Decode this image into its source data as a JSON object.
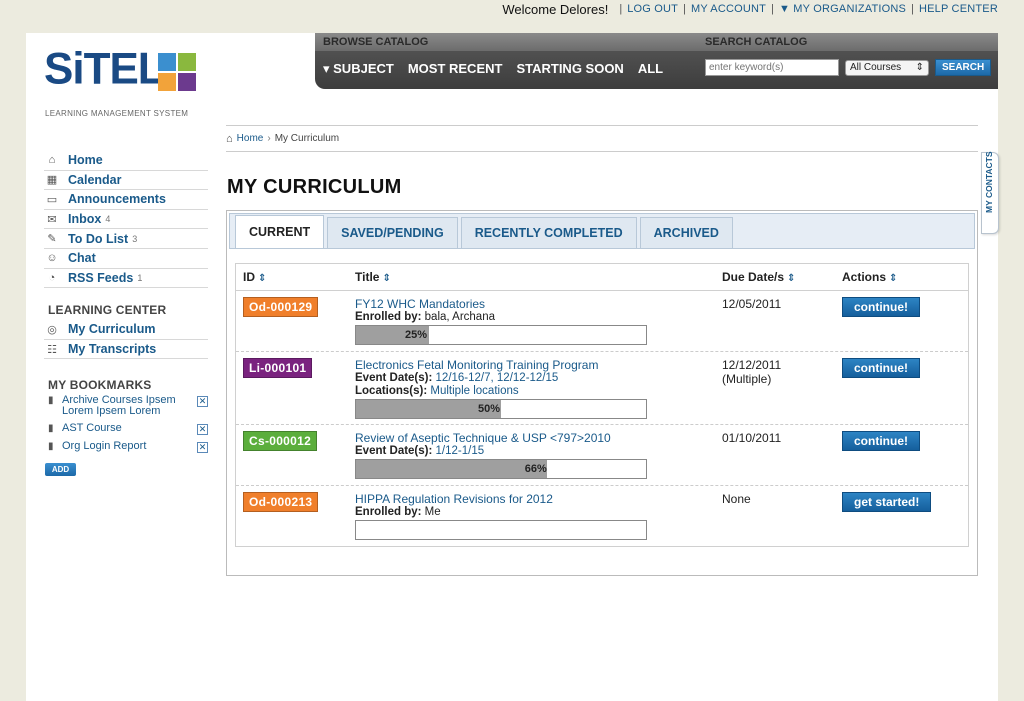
{
  "topbar": {
    "welcome": "Welcome Delores!",
    "logout": "LOG OUT",
    "my_account": "MY ACCOUNT",
    "my_organizations": "MY ORGANIZATIONS",
    "help_center": "HELP CENTER"
  },
  "logo": {
    "wordmark": "SiTEL",
    "tagline": "LEARNING MANAGEMENT SYSTEM"
  },
  "catalog": {
    "browse_label": "BROWSE CATALOG",
    "search_label": "SEARCH CATALOG",
    "nav": [
      "▾ SUBJECT",
      "MOST RECENT",
      "STARTING SOON",
      "ALL"
    ],
    "search_placeholder": "enter keyword(s)",
    "scope_selected": "All Courses",
    "search_button": "SEARCH"
  },
  "sidebar": {
    "items": [
      {
        "label": "Home",
        "icon": "home-icon",
        "count": ""
      },
      {
        "label": "Calendar",
        "icon": "calendar-icon",
        "count": ""
      },
      {
        "label": "Announcements",
        "icon": "announcement-icon",
        "count": ""
      },
      {
        "label": "Inbox",
        "icon": "inbox-icon",
        "count": "4"
      },
      {
        "label": "To Do List",
        "icon": "pin-icon",
        "count": "3"
      },
      {
        "label": "Chat",
        "icon": "chat-icon",
        "count": ""
      },
      {
        "label": "RSS Feeds",
        "icon": "rss-icon",
        "count": "1"
      }
    ],
    "learning_center_heading": "LEARNING CENTER",
    "learning_center": [
      {
        "label": "My Curriculum",
        "icon": "curriculum-icon"
      },
      {
        "label": "My Transcripts",
        "icon": "transcripts-icon"
      }
    ],
    "bookmarks_heading": "MY BOOKMARKS",
    "bookmarks": [
      {
        "label": "Archive Courses Ipsem Lorem Ipsem Lorem"
      },
      {
        "label": "AST Course"
      },
      {
        "label": "Org Login Report"
      }
    ],
    "add_button": "ADD"
  },
  "contacts_tab": "MY CONTACTS",
  "breadcrumb": {
    "home": "Home",
    "current": "My Curriculum"
  },
  "page_title": "MY CURRICULUM",
  "tabs": [
    {
      "label": "CURRENT",
      "active": true
    },
    {
      "label": "SAVED/PENDING",
      "active": false
    },
    {
      "label": "RECENTLY COMPLETED",
      "active": false
    },
    {
      "label": "ARCHIVED",
      "active": false
    }
  ],
  "table": {
    "headers": {
      "id": "ID",
      "title": "Title",
      "due": "Due Date/s",
      "actions": "Actions"
    },
    "rows": [
      {
        "id": "Od-000129",
        "badge_color": "#f07f2b",
        "title": "FY12 WHC Mandatories",
        "meta_label": "Enrolled by:",
        "meta_value": "bala, Archana",
        "meta_value_linked": false,
        "meta2_label": "",
        "meta2_value": "",
        "progress": 25,
        "progress_text": "25%",
        "due": "12/05/2011",
        "due2": "",
        "action": "continue!"
      },
      {
        "id": "Li-000101",
        "badge_color": "#7a237f",
        "title": "Electronics Fetal Monitoring Training Program",
        "meta_label": "Event Date(s):",
        "meta_value": "12/16-12/7, 12/12-12/15",
        "meta_value_linked": true,
        "meta2_label": "Locations(s):",
        "meta2_value": "Multiple locations",
        "progress": 50,
        "progress_text": "50%",
        "due": "12/12/2011",
        "due2": "(Multiple)",
        "action": "continue!"
      },
      {
        "id": "Cs-000012",
        "badge_color": "#5bae3c",
        "title": "Review of Aseptic Technique & USP <797>2010",
        "meta_label": "Event Date(s):",
        "meta_value": "1/12-1/15",
        "meta_value_linked": true,
        "meta2_label": "",
        "meta2_value": "",
        "progress": 66,
        "progress_text": "66%",
        "due": "01/10/2011",
        "due2": "",
        "action": "continue!"
      },
      {
        "id": "Od-000213",
        "badge_color": "#f07f2b",
        "title": "HIPPA Regulation Revisions for 2012",
        "meta_label": "Enrolled by:",
        "meta_value": "Me",
        "meta_value_linked": false,
        "meta2_label": "",
        "meta2_value": "",
        "progress": 0,
        "progress_text": "",
        "due": "None",
        "due2": "",
        "action": "get started!"
      }
    ]
  }
}
